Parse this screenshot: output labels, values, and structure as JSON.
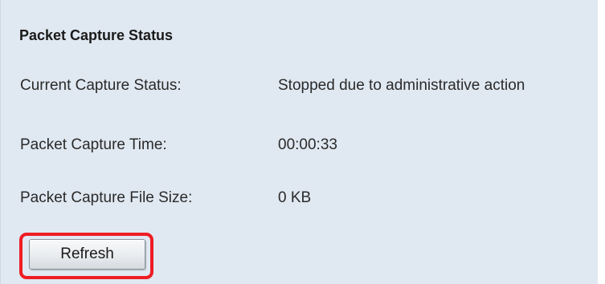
{
  "panel": {
    "title": "Packet Capture Status",
    "rows": [
      {
        "label": "Current Capture Status:",
        "value": "Stopped due to administrative action"
      },
      {
        "label": "Packet Capture Time:",
        "value": "00:00:33"
      },
      {
        "label": "Packet Capture File Size:",
        "value": "0 KB"
      }
    ]
  },
  "actions": {
    "refresh_label": "Refresh",
    "highlight_color": "#ee1d23"
  },
  "colors": {
    "panel_background": "#e0e8f1"
  }
}
